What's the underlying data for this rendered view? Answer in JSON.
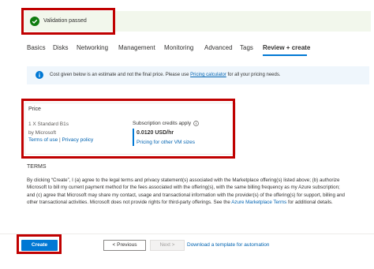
{
  "validation": {
    "message": "Validation passed",
    "status_color": "#107c10"
  },
  "tabs": [
    "Basics",
    "Disks",
    "Networking",
    "Management",
    "Monitoring",
    "Advanced",
    "Tags",
    "Review + create"
  ],
  "active_tab": "Review + create",
  "info_bar": {
    "text_before": "Cost given below is an estimate and not the final price. Please use",
    "link": "Pricing calculator",
    "text_after": "for all your pricing needs."
  },
  "price": {
    "heading": "Price",
    "vm": "1 X Standard B1s",
    "vendor": "by Microsoft",
    "terms_link": "Terms of use",
    "separator": "|",
    "privacy_link": "Privacy policy",
    "credits_label": "Subscription credits apply",
    "rate": "0.0120 USD/hr",
    "pricing_link": "Pricing for other VM sizes"
  },
  "terms": {
    "heading": "TERMS",
    "text_before": "By clicking “Create”, I (a) agree to the legal terms and privacy statement(s) associated with the Marketplace offering(s) listed above; (b) authorize Microsoft to bill my current payment method for the fees associated with the offering(s), with the same billing frequency as my Azure subscription; and (c) agree that Microsoft may share my contact, usage and transactional information with the provider(s) of the offering(s) for support, billing and other transactional activities. Microsoft does not provide rights for third-party offerings. See the",
    "link": "Azure Marketplace Terms",
    "text_after": "for additional details."
  },
  "footer": {
    "create": "Create",
    "previous": "< Previous",
    "next": "Next >",
    "download_link": "Download a template for automation"
  },
  "colors": {
    "accent": "#0078d4",
    "highlight": "#c00000",
    "validation_bg": "#f2f7ec",
    "info_bg": "#eff6fc"
  }
}
